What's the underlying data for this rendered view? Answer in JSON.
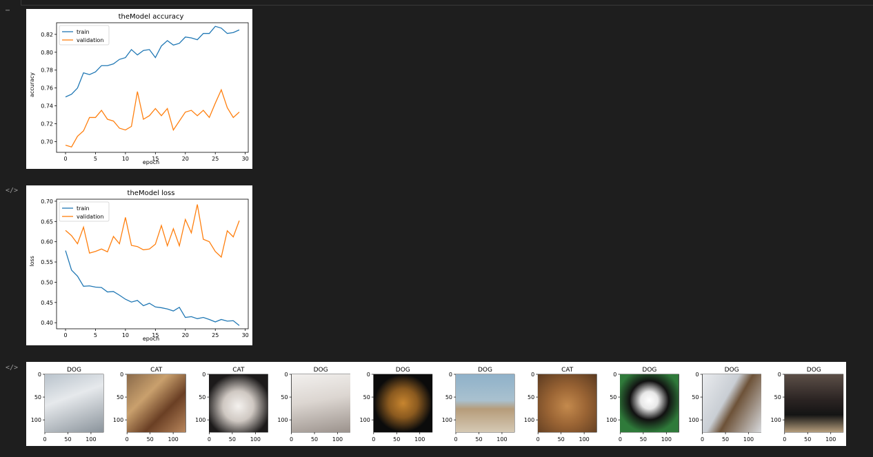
{
  "gutter": {
    "more_icon": "⋯",
    "code_icon": "</>"
  },
  "charts": [
    {
      "title": "theModel accuracy",
      "xlabel": "epoch",
      "ylabel": "accuracy",
      "legend": [
        "train",
        "validation"
      ],
      "xticks": [
        "0",
        "5",
        "10",
        "15",
        "20",
        "25",
        "30"
      ],
      "yticks": [
        "0.70",
        "0.72",
        "0.74",
        "0.76",
        "0.78",
        "0.80",
        "0.82"
      ]
    },
    {
      "title": "theModel loss",
      "xlabel": "epoch",
      "ylabel": "loss",
      "legend": [
        "train",
        "validation"
      ],
      "xticks": [
        "0",
        "5",
        "10",
        "15",
        "20",
        "25",
        "30"
      ],
      "yticks": [
        "0.40",
        "0.45",
        "0.50",
        "0.55",
        "0.60",
        "0.65",
        "0.70"
      ]
    }
  ],
  "chart_data": [
    {
      "type": "line",
      "title": "theModel accuracy",
      "xlabel": "epoch",
      "ylabel": "accuracy",
      "xlim": [
        -1.5,
        30.5
      ],
      "ylim": [
        0.688,
        0.833
      ],
      "legend_position": "top-left",
      "grid": false,
      "x": [
        0,
        1,
        2,
        3,
        4,
        5,
        6,
        7,
        8,
        9,
        10,
        11,
        12,
        13,
        14,
        15,
        16,
        17,
        18,
        19,
        20,
        21,
        22,
        23,
        24,
        25,
        26,
        27,
        28,
        29
      ],
      "series": [
        {
          "name": "train",
          "color": "#1f77b4",
          "values": [
            0.75,
            0.753,
            0.76,
            0.777,
            0.775,
            0.778,
            0.785,
            0.785,
            0.787,
            0.792,
            0.794,
            0.803,
            0.797,
            0.802,
            0.803,
            0.794,
            0.807,
            0.813,
            0.808,
            0.81,
            0.817,
            0.816,
            0.814,
            0.821,
            0.821,
            0.829,
            0.827,
            0.821,
            0.822,
            0.825
          ]
        },
        {
          "name": "validation",
          "color": "#ff7f0e",
          "values": [
            0.696,
            0.694,
            0.706,
            0.712,
            0.727,
            0.727,
            0.735,
            0.725,
            0.723,
            0.715,
            0.713,
            0.717,
            0.756,
            0.725,
            0.729,
            0.737,
            0.729,
            0.737,
            0.713,
            0.723,
            0.733,
            0.735,
            0.729,
            0.735,
            0.727,
            0.743,
            0.758,
            0.738,
            0.727,
            0.733
          ]
        }
      ]
    },
    {
      "type": "line",
      "title": "theModel loss",
      "xlabel": "epoch",
      "ylabel": "loss",
      "xlim": [
        -1.5,
        30.5
      ],
      "ylim": [
        0.385,
        0.705
      ],
      "legend_position": "top-left",
      "grid": false,
      "x": [
        0,
        1,
        2,
        3,
        4,
        5,
        6,
        7,
        8,
        9,
        10,
        11,
        12,
        13,
        14,
        15,
        16,
        17,
        18,
        19,
        20,
        21,
        22,
        23,
        24,
        25,
        26,
        27,
        28,
        29
      ],
      "series": [
        {
          "name": "train",
          "color": "#1f77b4",
          "values": [
            0.578,
            0.53,
            0.515,
            0.49,
            0.491,
            0.488,
            0.487,
            0.476,
            0.477,
            0.468,
            0.458,
            0.451,
            0.455,
            0.442,
            0.448,
            0.439,
            0.437,
            0.434,
            0.429,
            0.438,
            0.413,
            0.415,
            0.41,
            0.413,
            0.408,
            0.402,
            0.408,
            0.404,
            0.405,
            0.393
          ]
        },
        {
          "name": "validation",
          "color": "#ff7f0e",
          "values": [
            0.628,
            0.615,
            0.595,
            0.636,
            0.572,
            0.576,
            0.582,
            0.575,
            0.613,
            0.595,
            0.66,
            0.591,
            0.588,
            0.58,
            0.582,
            0.594,
            0.64,
            0.59,
            0.632,
            0.59,
            0.655,
            0.622,
            0.692,
            0.606,
            0.6,
            0.576,
            0.562,
            0.627,
            0.612,
            0.652
          ]
        }
      ]
    }
  ],
  "images": {
    "yticks": [
      "0",
      "50",
      "100"
    ],
    "xticks": [
      "0",
      "50",
      "100"
    ],
    "panels": [
      {
        "label": "DOG",
        "bg": "linear-gradient(160deg,#b9c3cc 0%,#e6e9ec 40%,#8a939b 100%)"
      },
      {
        "label": "CAT",
        "bg": "linear-gradient(135deg,#8a6a4a 0%,#c9a06d 35%,#6a3f24 65%,#b8865c 100%)"
      },
      {
        "label": "CAT",
        "bg": "radial-gradient(circle at 50% 55%,#f4f1ee 0%,#cfc8c2 35%,#1c1a1a 75%)"
      },
      {
        "label": "DOG",
        "bg": "linear-gradient(170deg,#f2f0ee 0%,#dcd6d1 45%,#9b928c 100%)"
      },
      {
        "label": "DOG",
        "bg": "radial-gradient(circle at 50% 50%,#c7852f 0%,#8b5a1f 35%,#0b0b0b 70%)"
      },
      {
        "label": "DOG",
        "bg": "linear-gradient(180deg,#8fb1c9 0%,#a9c1cf 45%,#b69c7a 60%,#d5c9b4 100%)"
      },
      {
        "label": "CAT",
        "bg": "radial-gradient(circle at 50% 55%,#c48a4d 0%,#9a6434 45%,#5b3a20 100%)"
      },
      {
        "label": "DOG",
        "bg": "radial-gradient(circle at 50% 45%,#ffffff 0%,#e8e8e8 20%,#111111 45%,#2f7a3a 75%)"
      },
      {
        "label": "DOG",
        "bg": "linear-gradient(120deg,#e9ebee 0%,#c9ced4 40%,#6d5238 55%,#d8dadd 100%)"
      },
      {
        "label": "DOG",
        "bg": "linear-gradient(180deg,#5c4f48 0%,#2a2322 45%,#141414 70%,#b59d7c 100%)"
      }
    ]
  }
}
